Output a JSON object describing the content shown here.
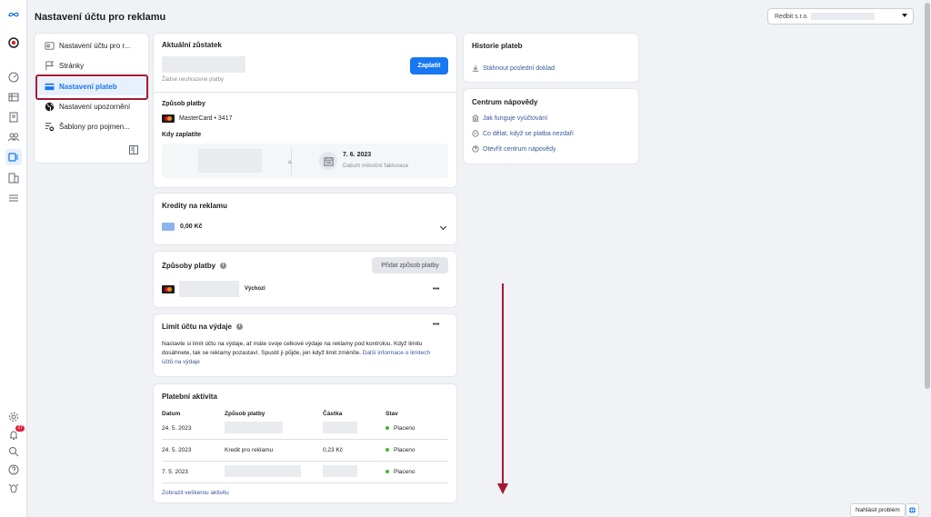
{
  "page": {
    "title": "Nastavení účtu pro reklamu"
  },
  "account_selector": {
    "value": "Redbit s.r.o."
  },
  "menu": {
    "items": [
      {
        "label": "Nastavení účtu pro r...",
        "icon": "ad-account-icon"
      },
      {
        "label": "Stránky",
        "icon": "flag-icon"
      },
      {
        "label": "Nastavení plateb",
        "icon": "credit-card-icon"
      },
      {
        "label": "Nastavení upozornění",
        "icon": "globe-icon"
      },
      {
        "label": "Šablony pro pojmen...",
        "icon": "template-icon"
      }
    ],
    "active_index": 2
  },
  "balance": {
    "title": "Aktuální zůstatek",
    "sub": "Žádné neuhrazené platby",
    "pay_button": "Zaplatit",
    "method_label": "Způsob platby",
    "method_value": "MasterCard • 3417",
    "when_label": "Kdy zaplatíte",
    "or": "a",
    "date": "7. 6. 2023",
    "date_caption": "Datum měsíční fakturace"
  },
  "credits": {
    "title": "Kredity na reklamu",
    "value": "0,00 Kč"
  },
  "methods": {
    "title": "Způsoby platby",
    "add_button": "Přidat způsob platby",
    "default_tag": "Výchozí",
    "more": "•••"
  },
  "limit": {
    "title": "Limit účtu na výdaje",
    "more": "•••",
    "text": "Nastavte si limit účtu na výdaje, ať máte svoje celkové výdaje na reklamy pod kontrolou. Když limitu dosáhnete, tak se reklamy pozastaví. Spustit ji půjde, jen když limit změníte.",
    "link": "Další informace o limitech účtů na výdaje"
  },
  "activity": {
    "title": "Platební aktivita",
    "columns": [
      "Datum",
      "Způsob platby",
      "Částka",
      "Stav"
    ],
    "rows": [
      {
        "date": "24. 5. 2023",
        "method": "",
        "amount": "",
        "status": "Placeno"
      },
      {
        "date": "24. 5. 2023",
        "method": "Kredit pro reklamu",
        "amount": "0,23 Kč",
        "status": "Placeno"
      },
      {
        "date": "7. 5. 2023",
        "method": "",
        "amount": "",
        "status": "Placeno"
      }
    ],
    "link": "Zobrazit veškerou aktivitu"
  },
  "history": {
    "title": "Historie plateb",
    "download": "Stáhnout poslední doklad"
  },
  "help": {
    "title": "Centrum nápovědy",
    "links": [
      "Jak funguje vyúčtování",
      "Co dělat, když se platba nezdaří",
      "Otevřít centrum nápovědy"
    ]
  },
  "footer": {
    "report": "Nahlásit problém"
  },
  "notifications": {
    "count": "27"
  },
  "colors": {
    "accent": "#1877f2",
    "annotation": "#a51735",
    "status_paid": "#42b72a"
  }
}
